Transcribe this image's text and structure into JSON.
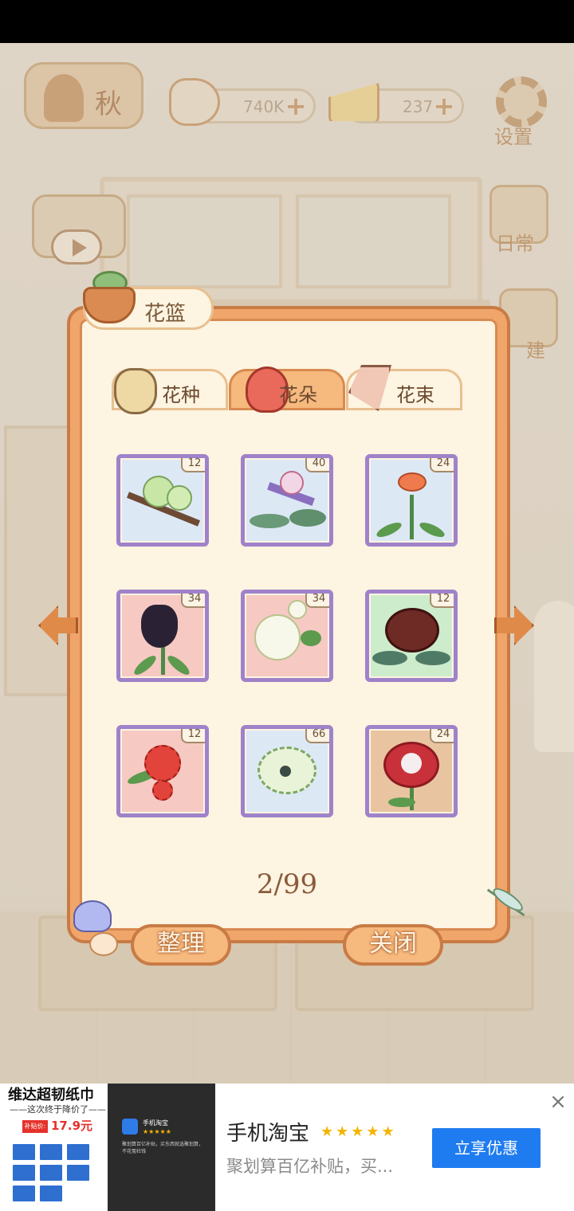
{
  "hud": {
    "season_label": "秋",
    "fish_count": "740K",
    "cheese_count": "237",
    "settings_label": "设置",
    "diary_label": "日常",
    "build_label": "建"
  },
  "dialog": {
    "title": "花篮",
    "tabs": [
      {
        "label": "花种",
        "icon": "seed-bag-icon",
        "active": false
      },
      {
        "label": "花朵",
        "icon": "rose-icon",
        "active": true
      },
      {
        "label": "花束",
        "icon": "bouquet-icon",
        "active": false
      }
    ],
    "items": [
      {
        "count": "12",
        "flower": "green-plum-blossom",
        "bg": "#dde8f5"
      },
      {
        "count": "40",
        "flower": "bird-of-paradise",
        "bg": "#dde8f5"
      },
      {
        "count": "24",
        "flower": "orange-carnation",
        "bg": "#dde8f5"
      },
      {
        "count": "34",
        "flower": "black-tulip",
        "bg": "#f6c9c3"
      },
      {
        "count": "34",
        "flower": "white-morning-glory",
        "bg": "#f6c9c3"
      },
      {
        "count": "12",
        "flower": "dark-red-peony",
        "bg": "#cdeccb"
      },
      {
        "count": "12",
        "flower": "red-spider-lily",
        "bg": "#f6c9c3"
      },
      {
        "count": "66",
        "flower": "white-chrysanthemum",
        "bg": "#dde8f5"
      },
      {
        "count": "24",
        "flower": "red-columbine",
        "bg": "#e9c4a0"
      }
    ],
    "page_indicator": "2/99",
    "organize_label": "整理",
    "close_label": "关闭"
  },
  "ad": {
    "image_headline": "维达超韧纸巾",
    "image_subline": "——这次终于降价了——",
    "price_tag": "补贴价:",
    "price": "17.9元",
    "card_app_name": "手机淘宝",
    "card_stars": "★★★★★",
    "card_desc": "聚划算百亿补贴，买东西就选聚划算，不花冤枉钱",
    "app_name": "手机淘宝",
    "stars": "★★★★★",
    "description": "聚划算百亿补贴，买...",
    "cta": "立享优惠",
    "close": "×"
  }
}
